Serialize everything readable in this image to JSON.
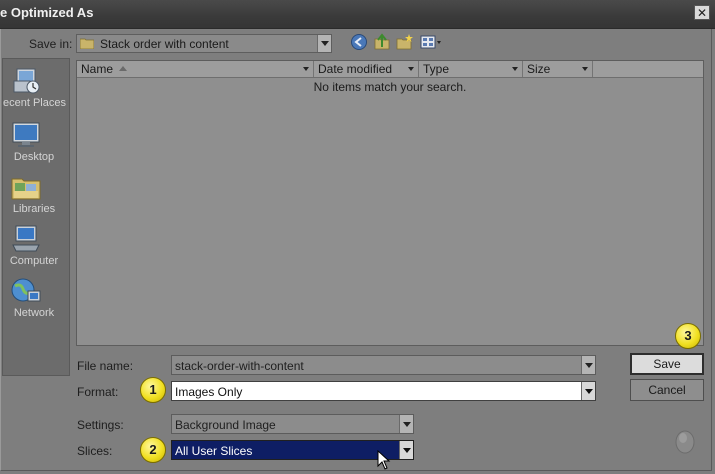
{
  "window": {
    "title": "e Optimized As",
    "close_glyph": "✕"
  },
  "save_in": {
    "label": "Save in:",
    "value": "Stack order with content"
  },
  "places": [
    {
      "name": "recent-places",
      "label": "ecent Places",
      "icon": "recent-places-icon"
    },
    {
      "name": "desktop",
      "label": "Desktop",
      "icon": "desktop-icon"
    },
    {
      "name": "libraries",
      "label": "Libraries",
      "icon": "libraries-icon"
    },
    {
      "name": "computer",
      "label": "Computer",
      "icon": "computer-icon"
    },
    {
      "name": "network",
      "label": "Network",
      "icon": "network-icon"
    }
  ],
  "file_list": {
    "columns": [
      "Name",
      "Date modified",
      "Type",
      "Size"
    ],
    "empty_message": "No items match your search."
  },
  "form": {
    "file_name_label": "File name:",
    "file_name_value": "stack-order-with-content",
    "format_label": "Format:",
    "format_value": "Images Only",
    "settings_label": "Settings:",
    "settings_value": "Background Image",
    "slices_label": "Slices:",
    "slices_value": "All User Slices"
  },
  "buttons": {
    "save": "Save",
    "cancel": "Cancel"
  },
  "badges": {
    "format": "1",
    "slices": "2",
    "save": "3"
  },
  "colors": {
    "badge": "#f1e022",
    "selection": "#0e1e64",
    "background": "#7e7e7e"
  }
}
